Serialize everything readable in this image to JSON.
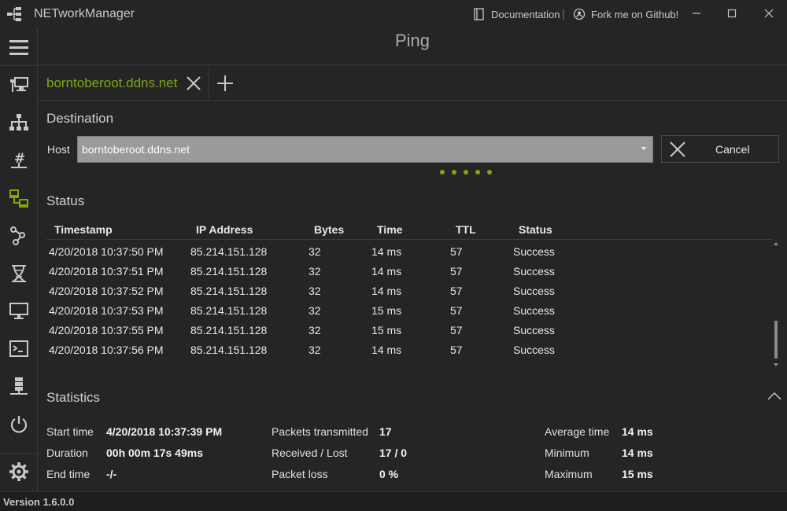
{
  "app": {
    "title": "NETworkManager",
    "documentation_label": "Documentation",
    "github_label": "Fork me on Github!",
    "separator": "|"
  },
  "page": {
    "title": "Ping"
  },
  "tabs": [
    {
      "label": "borntoberoot.ddns.net"
    }
  ],
  "destination": {
    "heading": "Destination",
    "host_label": "Host",
    "host_value": "borntoberoot.ddns.net",
    "cancel_label": "Cancel"
  },
  "status": {
    "heading": "Status",
    "columns": [
      "Timestamp",
      "IP Address",
      "Bytes",
      "Time",
      "TTL",
      "Status"
    ],
    "rows": [
      [
        "4/20/2018 10:37:50 PM",
        "85.214.151.128",
        "32",
        "14 ms",
        "57",
        "Success"
      ],
      [
        "4/20/2018 10:37:51 PM",
        "85.214.151.128",
        "32",
        "14 ms",
        "57",
        "Success"
      ],
      [
        "4/20/2018 10:37:52 PM",
        "85.214.151.128",
        "32",
        "14 ms",
        "57",
        "Success"
      ],
      [
        "4/20/2018 10:37:53 PM",
        "85.214.151.128",
        "32",
        "15 ms",
        "57",
        "Success"
      ],
      [
        "4/20/2018 10:37:55 PM",
        "85.214.151.128",
        "32",
        "15 ms",
        "57",
        "Success"
      ],
      [
        "4/20/2018 10:37:56 PM",
        "85.214.151.128",
        "32",
        "14 ms",
        "57",
        "Success"
      ]
    ]
  },
  "statistics": {
    "heading": "Statistics",
    "start_time_label": "Start time",
    "start_time_value": "4/20/2018 10:37:39 PM",
    "duration_label": "Duration",
    "duration_value": "00h 00m 17s 49ms",
    "end_time_label": "End time",
    "end_time_value": "-/-",
    "packets_transmitted_label": "Packets transmitted",
    "packets_transmitted_value": "17",
    "received_lost_label": "Received / Lost",
    "received_lost_value": "17 / 0",
    "packet_loss_label": "Packet loss",
    "packet_loss_value": "0 %",
    "average_time_label": "Average time",
    "average_time_value": "14 ms",
    "minimum_label": "Minimum",
    "minimum_value": "14 ms",
    "maximum_label": "Maximum",
    "maximum_value": "15 ms"
  },
  "sidebar": {
    "active_item": "ping",
    "items": [
      "menu-icon",
      "remote-desktop-icon",
      "network-topology-icon",
      "hash-network-icon",
      "ping-icon",
      "traceroute-icon",
      "dna-icon",
      "monitor-icon",
      "terminal-icon",
      "server-icon",
      "power-icon",
      "settings-icon"
    ]
  },
  "footer": {
    "version": "Version 1.6.0.0"
  },
  "theme": {
    "accent": "#7fa80e",
    "background": "#252526"
  }
}
